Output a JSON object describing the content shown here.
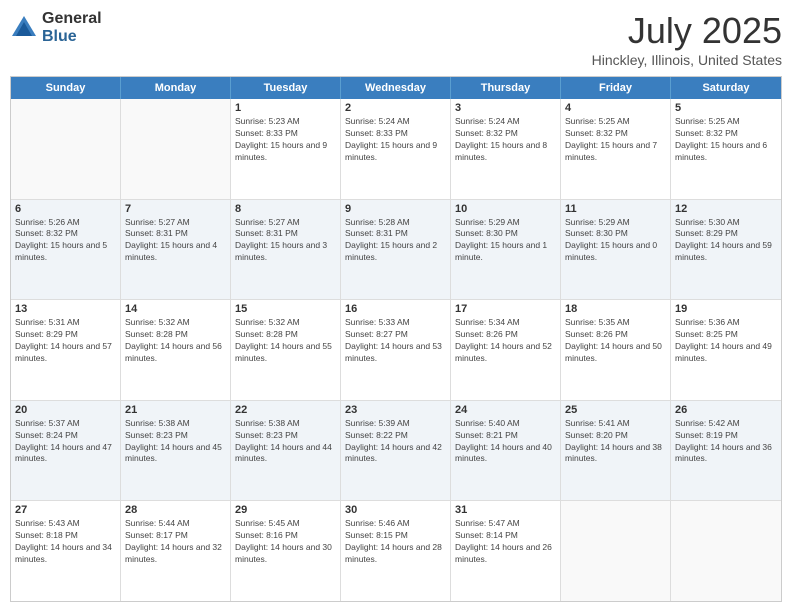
{
  "logo": {
    "general": "General",
    "blue": "Blue"
  },
  "title": "July 2025",
  "subtitle": "Hinckley, Illinois, United States",
  "header_days": [
    "Sunday",
    "Monday",
    "Tuesday",
    "Wednesday",
    "Thursday",
    "Friday",
    "Saturday"
  ],
  "weeks": [
    [
      {
        "day": "",
        "info": ""
      },
      {
        "day": "",
        "info": ""
      },
      {
        "day": "1",
        "info": "Sunrise: 5:23 AM\nSunset: 8:33 PM\nDaylight: 15 hours and 9 minutes."
      },
      {
        "day": "2",
        "info": "Sunrise: 5:24 AM\nSunset: 8:33 PM\nDaylight: 15 hours and 9 minutes."
      },
      {
        "day": "3",
        "info": "Sunrise: 5:24 AM\nSunset: 8:32 PM\nDaylight: 15 hours and 8 minutes."
      },
      {
        "day": "4",
        "info": "Sunrise: 5:25 AM\nSunset: 8:32 PM\nDaylight: 15 hours and 7 minutes."
      },
      {
        "day": "5",
        "info": "Sunrise: 5:25 AM\nSunset: 8:32 PM\nDaylight: 15 hours and 6 minutes."
      }
    ],
    [
      {
        "day": "6",
        "info": "Sunrise: 5:26 AM\nSunset: 8:32 PM\nDaylight: 15 hours and 5 minutes."
      },
      {
        "day": "7",
        "info": "Sunrise: 5:27 AM\nSunset: 8:31 PM\nDaylight: 15 hours and 4 minutes."
      },
      {
        "day": "8",
        "info": "Sunrise: 5:27 AM\nSunset: 8:31 PM\nDaylight: 15 hours and 3 minutes."
      },
      {
        "day": "9",
        "info": "Sunrise: 5:28 AM\nSunset: 8:31 PM\nDaylight: 15 hours and 2 minutes."
      },
      {
        "day": "10",
        "info": "Sunrise: 5:29 AM\nSunset: 8:30 PM\nDaylight: 15 hours and 1 minute."
      },
      {
        "day": "11",
        "info": "Sunrise: 5:29 AM\nSunset: 8:30 PM\nDaylight: 15 hours and 0 minutes."
      },
      {
        "day": "12",
        "info": "Sunrise: 5:30 AM\nSunset: 8:29 PM\nDaylight: 14 hours and 59 minutes."
      }
    ],
    [
      {
        "day": "13",
        "info": "Sunrise: 5:31 AM\nSunset: 8:29 PM\nDaylight: 14 hours and 57 minutes."
      },
      {
        "day": "14",
        "info": "Sunrise: 5:32 AM\nSunset: 8:28 PM\nDaylight: 14 hours and 56 minutes."
      },
      {
        "day": "15",
        "info": "Sunrise: 5:32 AM\nSunset: 8:28 PM\nDaylight: 14 hours and 55 minutes."
      },
      {
        "day": "16",
        "info": "Sunrise: 5:33 AM\nSunset: 8:27 PM\nDaylight: 14 hours and 53 minutes."
      },
      {
        "day": "17",
        "info": "Sunrise: 5:34 AM\nSunset: 8:26 PM\nDaylight: 14 hours and 52 minutes."
      },
      {
        "day": "18",
        "info": "Sunrise: 5:35 AM\nSunset: 8:26 PM\nDaylight: 14 hours and 50 minutes."
      },
      {
        "day": "19",
        "info": "Sunrise: 5:36 AM\nSunset: 8:25 PM\nDaylight: 14 hours and 49 minutes."
      }
    ],
    [
      {
        "day": "20",
        "info": "Sunrise: 5:37 AM\nSunset: 8:24 PM\nDaylight: 14 hours and 47 minutes."
      },
      {
        "day": "21",
        "info": "Sunrise: 5:38 AM\nSunset: 8:23 PM\nDaylight: 14 hours and 45 minutes."
      },
      {
        "day": "22",
        "info": "Sunrise: 5:38 AM\nSunset: 8:23 PM\nDaylight: 14 hours and 44 minutes."
      },
      {
        "day": "23",
        "info": "Sunrise: 5:39 AM\nSunset: 8:22 PM\nDaylight: 14 hours and 42 minutes."
      },
      {
        "day": "24",
        "info": "Sunrise: 5:40 AM\nSunset: 8:21 PM\nDaylight: 14 hours and 40 minutes."
      },
      {
        "day": "25",
        "info": "Sunrise: 5:41 AM\nSunset: 8:20 PM\nDaylight: 14 hours and 38 minutes."
      },
      {
        "day": "26",
        "info": "Sunrise: 5:42 AM\nSunset: 8:19 PM\nDaylight: 14 hours and 36 minutes."
      }
    ],
    [
      {
        "day": "27",
        "info": "Sunrise: 5:43 AM\nSunset: 8:18 PM\nDaylight: 14 hours and 34 minutes."
      },
      {
        "day": "28",
        "info": "Sunrise: 5:44 AM\nSunset: 8:17 PM\nDaylight: 14 hours and 32 minutes."
      },
      {
        "day": "29",
        "info": "Sunrise: 5:45 AM\nSunset: 8:16 PM\nDaylight: 14 hours and 30 minutes."
      },
      {
        "day": "30",
        "info": "Sunrise: 5:46 AM\nSunset: 8:15 PM\nDaylight: 14 hours and 28 minutes."
      },
      {
        "day": "31",
        "info": "Sunrise: 5:47 AM\nSunset: 8:14 PM\nDaylight: 14 hours and 26 minutes."
      },
      {
        "day": "",
        "info": ""
      },
      {
        "day": "",
        "info": ""
      }
    ]
  ],
  "alt_rows": [
    1,
    3
  ]
}
